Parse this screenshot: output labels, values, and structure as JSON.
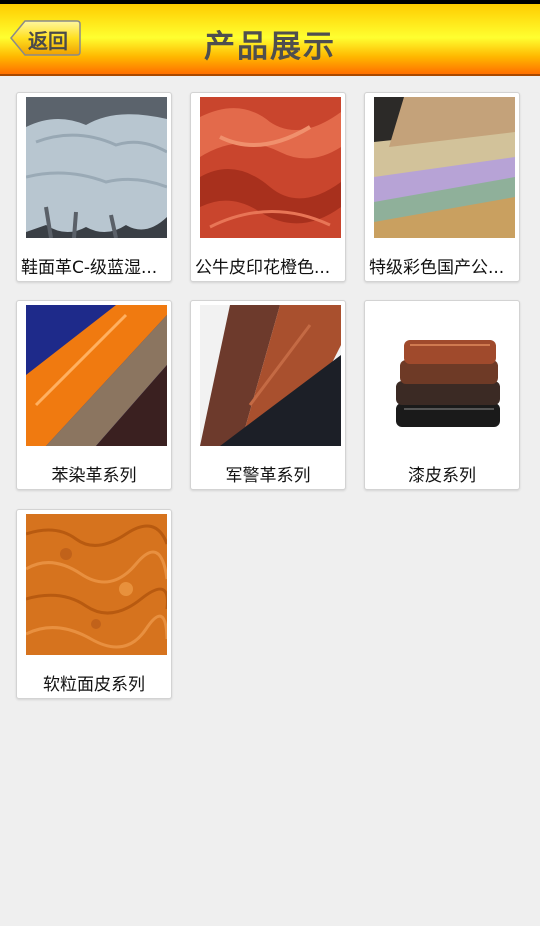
{
  "header": {
    "back_label": "返回",
    "title": "产品展示"
  },
  "products": [
    {
      "name": "鞋面革C-级蓝湿...",
      "image_icon": "blue-wet-leather-image"
    },
    {
      "name": "公牛皮印花橙色...",
      "image_icon": "orange-printed-leather-image"
    },
    {
      "name": "特级彩色国产公...",
      "image_icon": "colored-leather-stack-image"
    },
    {
      "name": "苯染革系列",
      "image_icon": "aniline-leather-image"
    },
    {
      "name": "军警革系列",
      "image_icon": "military-leather-image"
    },
    {
      "name": "漆皮系列",
      "image_icon": "patent-leather-image"
    },
    {
      "name": "软粒面皮系列",
      "image_icon": "soft-grain-leather-image"
    }
  ],
  "colors": {
    "header_top": "#ffcc00",
    "header_mid": "#ffff30",
    "header_bottom": "#ff7000",
    "page_background": "#efefef"
  }
}
